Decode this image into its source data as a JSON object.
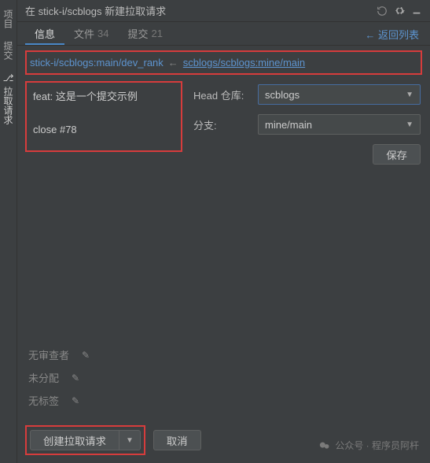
{
  "rail": {
    "tab0": "项目",
    "tab1": "提交",
    "tab2": "拉取请求"
  },
  "header": {
    "title": "在 stick-i/scblogs 新建拉取请求"
  },
  "tabs": {
    "info": "信息",
    "files": "文件",
    "files_count": "34",
    "commits": "提交",
    "commits_count": "21",
    "back": "← 返回列表"
  },
  "branches": {
    "dest": "stick-i/scblogs:main/dev_rank",
    "arrow": "←",
    "src": "scblogs/scblogs:mine/main"
  },
  "message": {
    "line1": "feat: 这是一个提交示例",
    "line2": "close #78"
  },
  "form": {
    "head_label": "Head 仓库:",
    "head_value": "scblogs",
    "branch_label": "分支:",
    "branch_value": "mine/main",
    "save": "保存"
  },
  "meta": {
    "reviewers": "无审查者",
    "assignees": "未分配",
    "labels": "无标签"
  },
  "bottom": {
    "create": "创建拉取请求",
    "cancel": "取消"
  },
  "watermark": "公众号 · 程序员阿杆"
}
